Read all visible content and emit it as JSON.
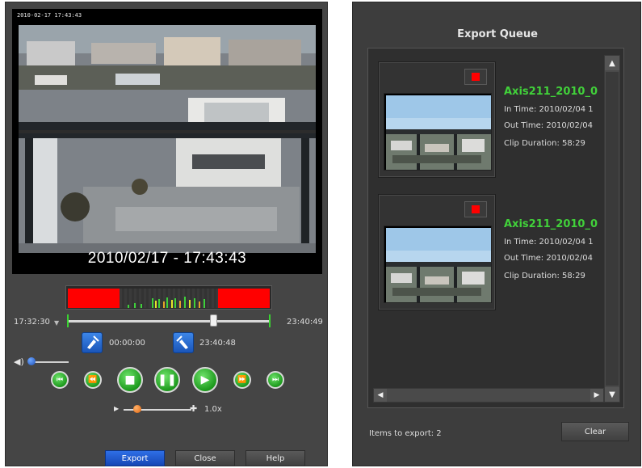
{
  "player": {
    "overlay_timestamp": "2010-02-17 17:43:43",
    "timestamp": "2010/02/17 - 17:43:43",
    "range_start": "17:32:30",
    "range_end": "23:40:49",
    "clip_in": "00:00:00",
    "clip_out": "23:40:48",
    "speed": "1.0x",
    "buttons": {
      "export": "Export",
      "close": "Close",
      "help": "Help"
    },
    "controls": {
      "first": "⏮",
      "rewind": "⏪",
      "stop": "■",
      "pause": "❚❚",
      "play": "▶",
      "forward": "⏩",
      "last": "⏭"
    },
    "icons": {
      "volume": "speaker-icon",
      "in": "clip-start-icon",
      "out": "clip-end-icon"
    },
    "colors": {
      "accent_blue": "#1d5fd6",
      "accent_green": "#2ab02a",
      "timeline_red": "#ff0000"
    },
    "scrub_position": 0.72,
    "volume_level": 0.05,
    "speed_level": 0.2
  },
  "queue": {
    "title": "Export Queue",
    "items": [
      {
        "name": "Axis211_2010_0",
        "in_time": "In Time: 2010/02/04 1",
        "out_time": "Out Time: 2010/02/04",
        "duration": "Clip Duration: 58:29"
      },
      {
        "name": "Axis211_2010_0",
        "in_time": "In Time: 2010/02/04 1",
        "out_time": "Out Time: 2010/02/04",
        "duration": "Clip Duration: 58:29"
      }
    ],
    "items_label": "Items to export: 2",
    "clear_label": "Clear",
    "scroll": {
      "up": "▲",
      "down": "▼",
      "left": "◀",
      "right": "▶"
    }
  }
}
